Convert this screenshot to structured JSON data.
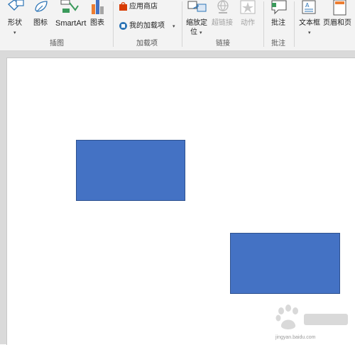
{
  "ribbon": {
    "illustrations": {
      "shapes_label": "形状",
      "icons_label": "图标",
      "smartart_label": "SmartArt",
      "chart_label": "图表",
      "group_label": "插图"
    },
    "addins": {
      "store_label": "应用商店",
      "my_addins_label": "我的加载项",
      "group_label": "加载项"
    },
    "links": {
      "zoom_label_line1": "缩放定",
      "zoom_label_line2": "位",
      "hyperlink_label": "超链接",
      "action_label": "动作",
      "group_label": "链接"
    },
    "comments": {
      "comment_label": "批注",
      "group_label": "批注"
    },
    "text": {
      "textbox_label": "文本框",
      "header_footer_label": "页眉和页"
    }
  },
  "colors": {
    "shape_fill": "#4472c4",
    "shape_border": "#2f528f",
    "ribbon_bg": "#f3f3f3"
  },
  "watermark": {
    "url": "jingyan.baidu.com"
  }
}
